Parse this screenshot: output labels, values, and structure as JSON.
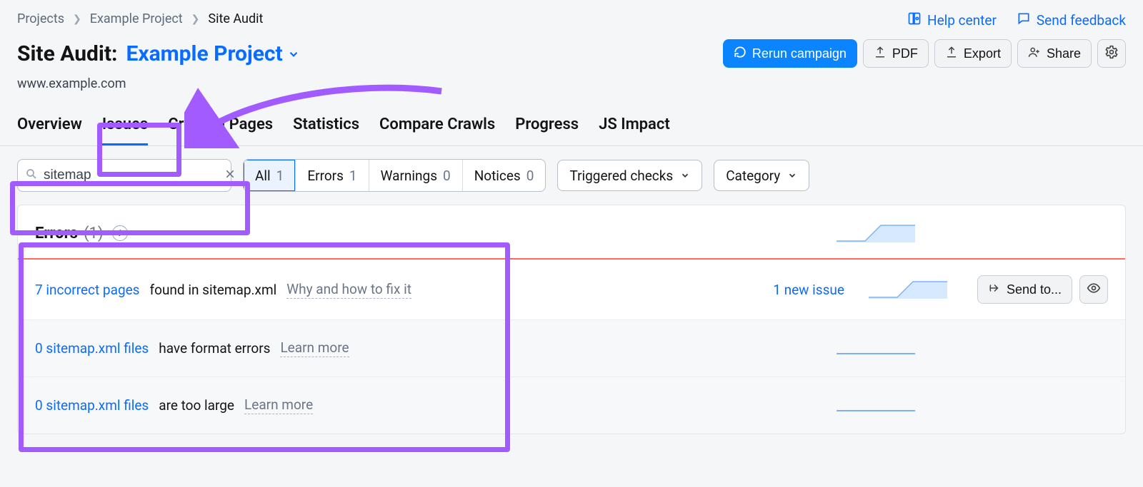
{
  "breadcrumb": {
    "items": [
      "Projects",
      "Example Project",
      "Site Audit"
    ]
  },
  "topLinks": {
    "help": "Help center",
    "feedback": "Send feedback"
  },
  "header": {
    "title_prefix": "Site Audit:",
    "project_name": "Example Project",
    "domain": "www.example.com"
  },
  "actions": {
    "rerun": "Rerun campaign",
    "pdf": "PDF",
    "export": "Export",
    "share": "Share"
  },
  "tabs": [
    "Overview",
    "Issues",
    "Crawled Pages",
    "Statistics",
    "Compare Crawls",
    "Progress",
    "JS Impact"
  ],
  "active_tab_index": 1,
  "search": {
    "value": "sitemap"
  },
  "filters": {
    "segments": [
      {
        "label": "All",
        "count": 1,
        "selected": true
      },
      {
        "label": "Errors",
        "count": 1,
        "selected": false
      },
      {
        "label": "Warnings",
        "count": 0,
        "selected": false
      },
      {
        "label": "Notices",
        "count": 0,
        "selected": false
      }
    ],
    "triggered": "Triggered checks",
    "category": "Category"
  },
  "errors_panel": {
    "title": "Errors",
    "count": "(1)",
    "rows": [
      {
        "link": "7 incorrect pages",
        "text": " found in sitemap.xml",
        "help": "Why and how to fix it",
        "new_issue": "1 new issue",
        "muted": false,
        "sendto": "Send to..."
      },
      {
        "link": "0 sitemap.xml files",
        "text": " have format errors",
        "help": "Learn more",
        "new_issue": "",
        "muted": true,
        "sendto": ""
      },
      {
        "link": "0 sitemap.xml files",
        "text": " are too large",
        "help": "Learn more",
        "new_issue": "",
        "muted": true,
        "sendto": ""
      }
    ]
  }
}
